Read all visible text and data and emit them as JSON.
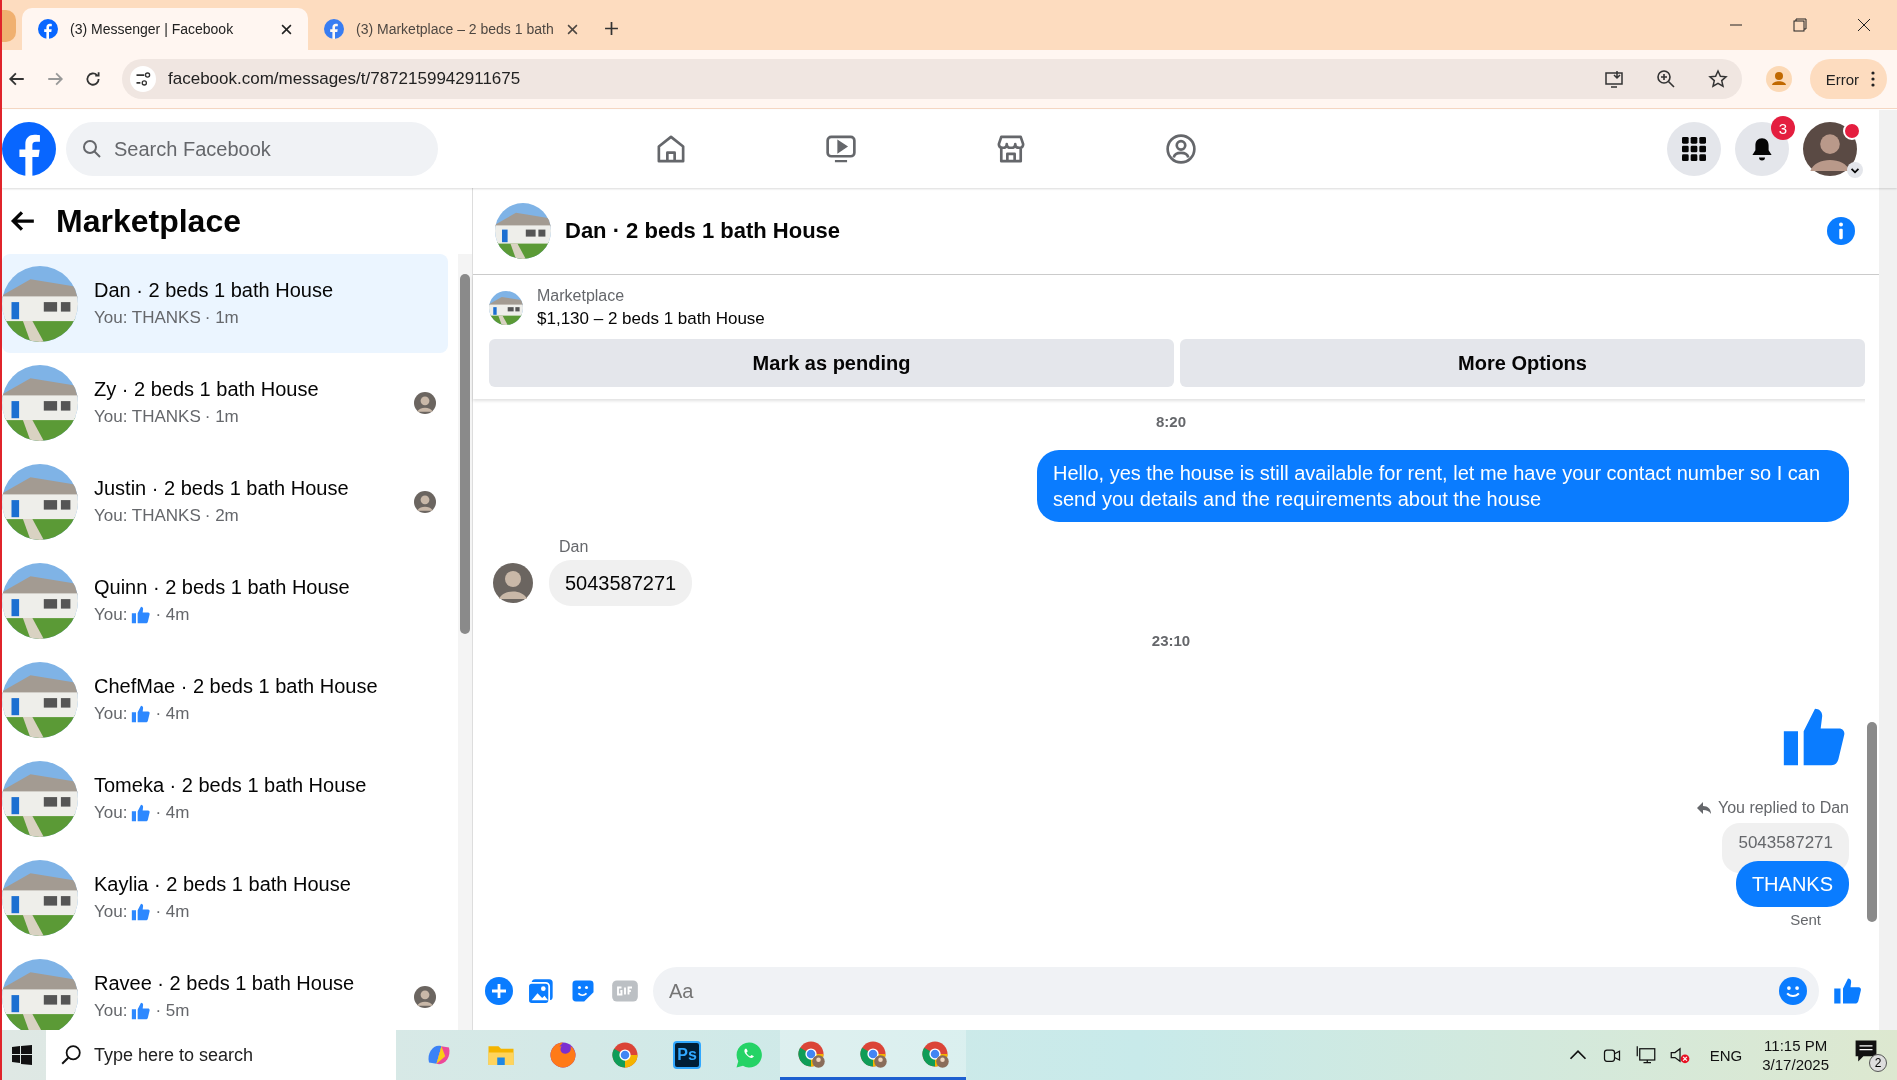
{
  "browser": {
    "tabs": [
      {
        "title": "(3) Messenger | Facebook",
        "selected": true
      },
      {
        "title": "(3) Marketplace – 2 beds 1 bath",
        "selected": false
      }
    ],
    "address": "facebook.com/messages/t/7872159942911675",
    "profile_label": "Error"
  },
  "header": {
    "search_placeholder": "Search Facebook",
    "notification_count": "3"
  },
  "sidebar": {
    "title": "Marketplace",
    "conversations": [
      {
        "title": "Dan · 2 beds 1 bath House",
        "kind": "text",
        "preview": "You: THANKS",
        "time": "· 1m",
        "selected": true,
        "seen": false
      },
      {
        "title": "Zy · 2 beds 1 bath House",
        "kind": "text",
        "preview": "You: THANKS",
        "time": "· 1m",
        "selected": false,
        "seen": true
      },
      {
        "title": "Justin · 2 beds 1 bath House",
        "kind": "text",
        "preview": "You: THANKS",
        "time": "· 2m",
        "selected": false,
        "seen": true
      },
      {
        "title": "Quinn · 2 beds 1 bath House",
        "kind": "like",
        "preview": "You:",
        "time": "· 4m",
        "selected": false,
        "seen": false
      },
      {
        "title": "ChefMae · 2 beds 1 bath House",
        "kind": "like",
        "preview": "You:",
        "time": "· 4m",
        "selected": false,
        "seen": false
      },
      {
        "title": "Tomeka · 2 beds 1 bath House",
        "kind": "like",
        "preview": "You:",
        "time": "· 4m",
        "selected": false,
        "seen": false
      },
      {
        "title": "Kaylia · 2 beds 1 bath House",
        "kind": "like",
        "preview": "You:",
        "time": "· 4m",
        "selected": false,
        "seen": false
      },
      {
        "title": "Ravee · 2 beds 1 bath House",
        "kind": "like",
        "preview": "You:",
        "time": "· 5m",
        "selected": false,
        "seen": true
      }
    ]
  },
  "chat": {
    "title": "Dan · 2 beds 1 bath House",
    "listing": {
      "label": "Marketplace",
      "title": "$1,130 – 2 beds 1 bath House"
    },
    "actions": [
      "Mark as pending",
      "More Options"
    ],
    "messages": [
      {
        "kind": "time",
        "text": "8:20"
      },
      {
        "kind": "outgoing",
        "text": "Hello, yes the house is still available for rent, let me have your contact number so I can send you details and the requirements about the house"
      },
      {
        "kind": "sender",
        "text": "Dan"
      },
      {
        "kind": "incoming",
        "text": "5043587271"
      },
      {
        "kind": "time",
        "text": "23:10"
      },
      {
        "kind": "like"
      },
      {
        "kind": "reply_note",
        "text": "You replied to Dan"
      },
      {
        "kind": "quote",
        "text": "5043587271"
      },
      {
        "kind": "outgoing",
        "text": "THANKS"
      },
      {
        "kind": "status",
        "text": "Sent"
      }
    ],
    "composer_placeholder": "Aa"
  },
  "taskbar": {
    "search_placeholder": "Type here to search",
    "apps": [
      {
        "kind": "swirl",
        "open": false
      },
      {
        "kind": "folder",
        "open": false
      },
      {
        "kind": "fox",
        "open": false
      },
      {
        "kind": "chrome",
        "open": false
      },
      {
        "kind": "ps",
        "label": "Ps",
        "open": false
      },
      {
        "kind": "chat",
        "open": false
      },
      {
        "kind": "chrome-user",
        "open": true
      },
      {
        "kind": "chrome-user",
        "open": true
      },
      {
        "kind": "chrome-user",
        "open": true
      }
    ],
    "language": "ENG",
    "time": "11:15 PM",
    "date": "3/17/2025",
    "notifications": "2"
  }
}
